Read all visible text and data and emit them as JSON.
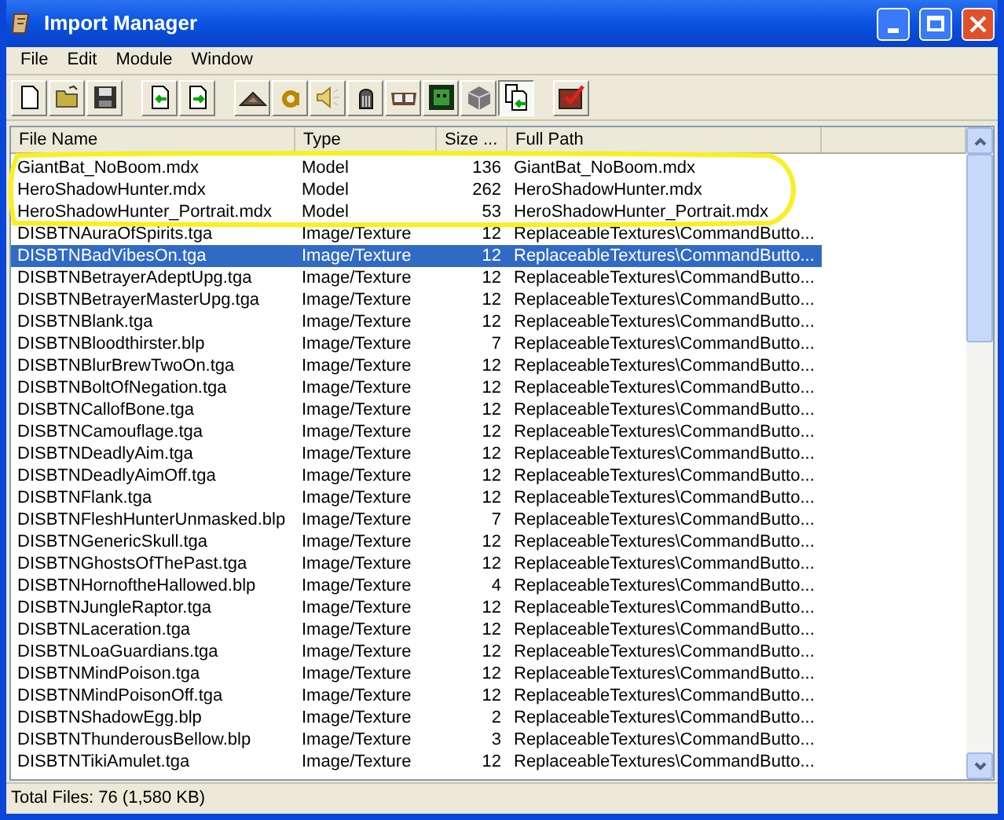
{
  "window": {
    "title": "Import Manager"
  },
  "menu": [
    "File",
    "Edit",
    "Module",
    "Window"
  ],
  "toolbar": [
    {
      "kind": "new",
      "pressed": false
    },
    {
      "kind": "open",
      "pressed": false
    },
    {
      "kind": "save",
      "pressed": false
    },
    {
      "kind": "sep"
    },
    {
      "kind": "import",
      "pressed": false
    },
    {
      "kind": "export",
      "pressed": false
    },
    {
      "kind": "sep"
    },
    {
      "kind": "terrain",
      "pressed": false
    },
    {
      "kind": "font",
      "pressed": false
    },
    {
      "kind": "sound",
      "pressed": false
    },
    {
      "kind": "model",
      "pressed": false
    },
    {
      "kind": "book",
      "pressed": false
    },
    {
      "kind": "face",
      "pressed": false
    },
    {
      "kind": "cube",
      "pressed": false
    },
    {
      "kind": "importfile",
      "pressed": true
    },
    {
      "kind": "sep"
    },
    {
      "kind": "check",
      "pressed": false
    }
  ],
  "table": {
    "columns": [
      "File Name",
      "Type",
      "Size ...",
      "Full Path"
    ],
    "rows": [
      {
        "name": "GiantBat_NoBoom.mdx",
        "type": "Model",
        "size": "136",
        "path": "GiantBat_NoBoom.mdx",
        "selected": false
      },
      {
        "name": "HeroShadowHunter.mdx",
        "type": "Model",
        "size": "262",
        "path": "HeroShadowHunter.mdx",
        "selected": false
      },
      {
        "name": "HeroShadowHunter_Portrait.mdx",
        "type": "Model",
        "size": "53",
        "path": "HeroShadowHunter_Portrait.mdx",
        "selected": false
      },
      {
        "name": "DISBTNAuraOfSpirits.tga",
        "type": "Image/Texture",
        "size": "12",
        "path": "ReplaceableTextures\\CommandButto...",
        "selected": false
      },
      {
        "name": "DISBTNBadVibesOn.tga",
        "type": "Image/Texture",
        "size": "12",
        "path": "ReplaceableTextures\\CommandButto...",
        "selected": true
      },
      {
        "name": "DISBTNBetrayerAdeptUpg.tga",
        "type": "Image/Texture",
        "size": "12",
        "path": "ReplaceableTextures\\CommandButto...",
        "selected": false
      },
      {
        "name": "DISBTNBetrayerMasterUpg.tga",
        "type": "Image/Texture",
        "size": "12",
        "path": "ReplaceableTextures\\CommandButto...",
        "selected": false
      },
      {
        "name": "DISBTNBlank.tga",
        "type": "Image/Texture",
        "size": "12",
        "path": "ReplaceableTextures\\CommandButto...",
        "selected": false
      },
      {
        "name": "DISBTNBloodthirster.blp",
        "type": "Image/Texture",
        "size": "7",
        "path": "ReplaceableTextures\\CommandButto...",
        "selected": false
      },
      {
        "name": "DISBTNBlurBrewTwoOn.tga",
        "type": "Image/Texture",
        "size": "12",
        "path": "ReplaceableTextures\\CommandButto...",
        "selected": false
      },
      {
        "name": "DISBTNBoltOfNegation.tga",
        "type": "Image/Texture",
        "size": "12",
        "path": "ReplaceableTextures\\CommandButto...",
        "selected": false
      },
      {
        "name": "DISBTNCallofBone.tga",
        "type": "Image/Texture",
        "size": "12",
        "path": "ReplaceableTextures\\CommandButto...",
        "selected": false
      },
      {
        "name": "DISBTNCamouflage.tga",
        "type": "Image/Texture",
        "size": "12",
        "path": "ReplaceableTextures\\CommandButto...",
        "selected": false
      },
      {
        "name": "DISBTNDeadlyAim.tga",
        "type": "Image/Texture",
        "size": "12",
        "path": "ReplaceableTextures\\CommandButto...",
        "selected": false
      },
      {
        "name": "DISBTNDeadlyAimOff.tga",
        "type": "Image/Texture",
        "size": "12",
        "path": "ReplaceableTextures\\CommandButto...",
        "selected": false
      },
      {
        "name": "DISBTNFlank.tga",
        "type": "Image/Texture",
        "size": "12",
        "path": "ReplaceableTextures\\CommandButto...",
        "selected": false
      },
      {
        "name": "DISBTNFleshHunterUnmasked.blp",
        "type": "Image/Texture",
        "size": "7",
        "path": "ReplaceableTextures\\CommandButto...",
        "selected": false
      },
      {
        "name": "DISBTNGenericSkull.tga",
        "type": "Image/Texture",
        "size": "12",
        "path": "ReplaceableTextures\\CommandButto...",
        "selected": false
      },
      {
        "name": "DISBTNGhostsOfThePast.tga",
        "type": "Image/Texture",
        "size": "12",
        "path": "ReplaceableTextures\\CommandButto...",
        "selected": false
      },
      {
        "name": "DISBTNHornoftheHallowed.blp",
        "type": "Image/Texture",
        "size": "4",
        "path": "ReplaceableTextures\\CommandButto...",
        "selected": false
      },
      {
        "name": "DISBTNJungleRaptor.tga",
        "type": "Image/Texture",
        "size": "12",
        "path": "ReplaceableTextures\\CommandButto...",
        "selected": false
      },
      {
        "name": "DISBTNLaceration.tga",
        "type": "Image/Texture",
        "size": "12",
        "path": "ReplaceableTextures\\CommandButto...",
        "selected": false
      },
      {
        "name": "DISBTNLoaGuardians.tga",
        "type": "Image/Texture",
        "size": "12",
        "path": "ReplaceableTextures\\CommandButto...",
        "selected": false
      },
      {
        "name": "DISBTNMindPoison.tga",
        "type": "Image/Texture",
        "size": "12",
        "path": "ReplaceableTextures\\CommandButto...",
        "selected": false
      },
      {
        "name": "DISBTNMindPoisonOff.tga",
        "type": "Image/Texture",
        "size": "12",
        "path": "ReplaceableTextures\\CommandButto...",
        "selected": false
      },
      {
        "name": "DISBTNShadowEgg.blp",
        "type": "Image/Texture",
        "size": "2",
        "path": "ReplaceableTextures\\CommandButto...",
        "selected": false
      },
      {
        "name": "DISBTNThunderousBellow.blp",
        "type": "Image/Texture",
        "size": "3",
        "path": "ReplaceableTextures\\CommandButto...",
        "selected": false
      },
      {
        "name": "DISBTNTikiAmulet.tga",
        "type": "Image/Texture",
        "size": "12",
        "path": "ReplaceableTextures\\CommandButto...",
        "selected": false
      }
    ]
  },
  "status_bar": "Total Files: 76 (1,580 KB)"
}
